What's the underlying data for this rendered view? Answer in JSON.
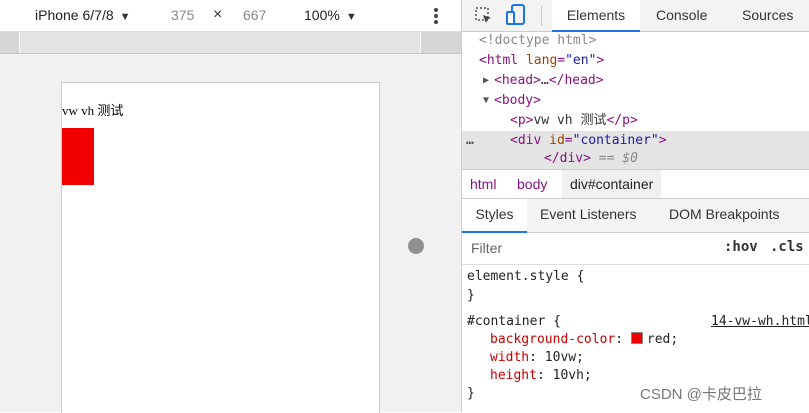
{
  "device_toolbar": {
    "device": "iPhone 6/7/8",
    "width": "375",
    "times": "×",
    "height": "667",
    "zoom": "100%"
  },
  "page": {
    "text": "vw vh 测试",
    "box_color": "#f20000"
  },
  "devtools": {
    "tabs": [
      "Elements",
      "Console",
      "Sources"
    ],
    "dom": {
      "doctype": "<!doctype html>",
      "html_tag": "html",
      "html_attr_name": "lang",
      "html_attr_value": "\"en\"",
      "head_tag": "head",
      "ellipsis": "…",
      "body_tag": "body",
      "p_tag": "p",
      "p_text": "vw vh 测试",
      "div_tag": "div",
      "div_attr_name": "id",
      "div_attr_value": "\"container\"",
      "selected_suffix": "== $0",
      "dots": "…"
    },
    "breadcrumbs": [
      "html",
      "body",
      "div#container"
    ],
    "sub_tabs": [
      "Styles",
      "Event Listeners",
      "DOM Breakpoints"
    ],
    "filter": {
      "placeholder": "Filter",
      "hov": ":hov",
      "cls": ".cls"
    },
    "element_style": {
      "selector": "element.style {",
      "close": "}"
    },
    "rule": {
      "selector": "#container {",
      "source": "14-vw-wh.html",
      "close": "}",
      "declarations": [
        {
          "prop": "background-color",
          "value": "red;"
        },
        {
          "prop": "width",
          "value": "10vw;"
        },
        {
          "prop": "height",
          "value": "10vh;"
        }
      ],
      "swatch_color": "#f20000"
    },
    "accent_color": "#1a73e8"
  },
  "watermark": "CSDN @卡皮巴拉"
}
